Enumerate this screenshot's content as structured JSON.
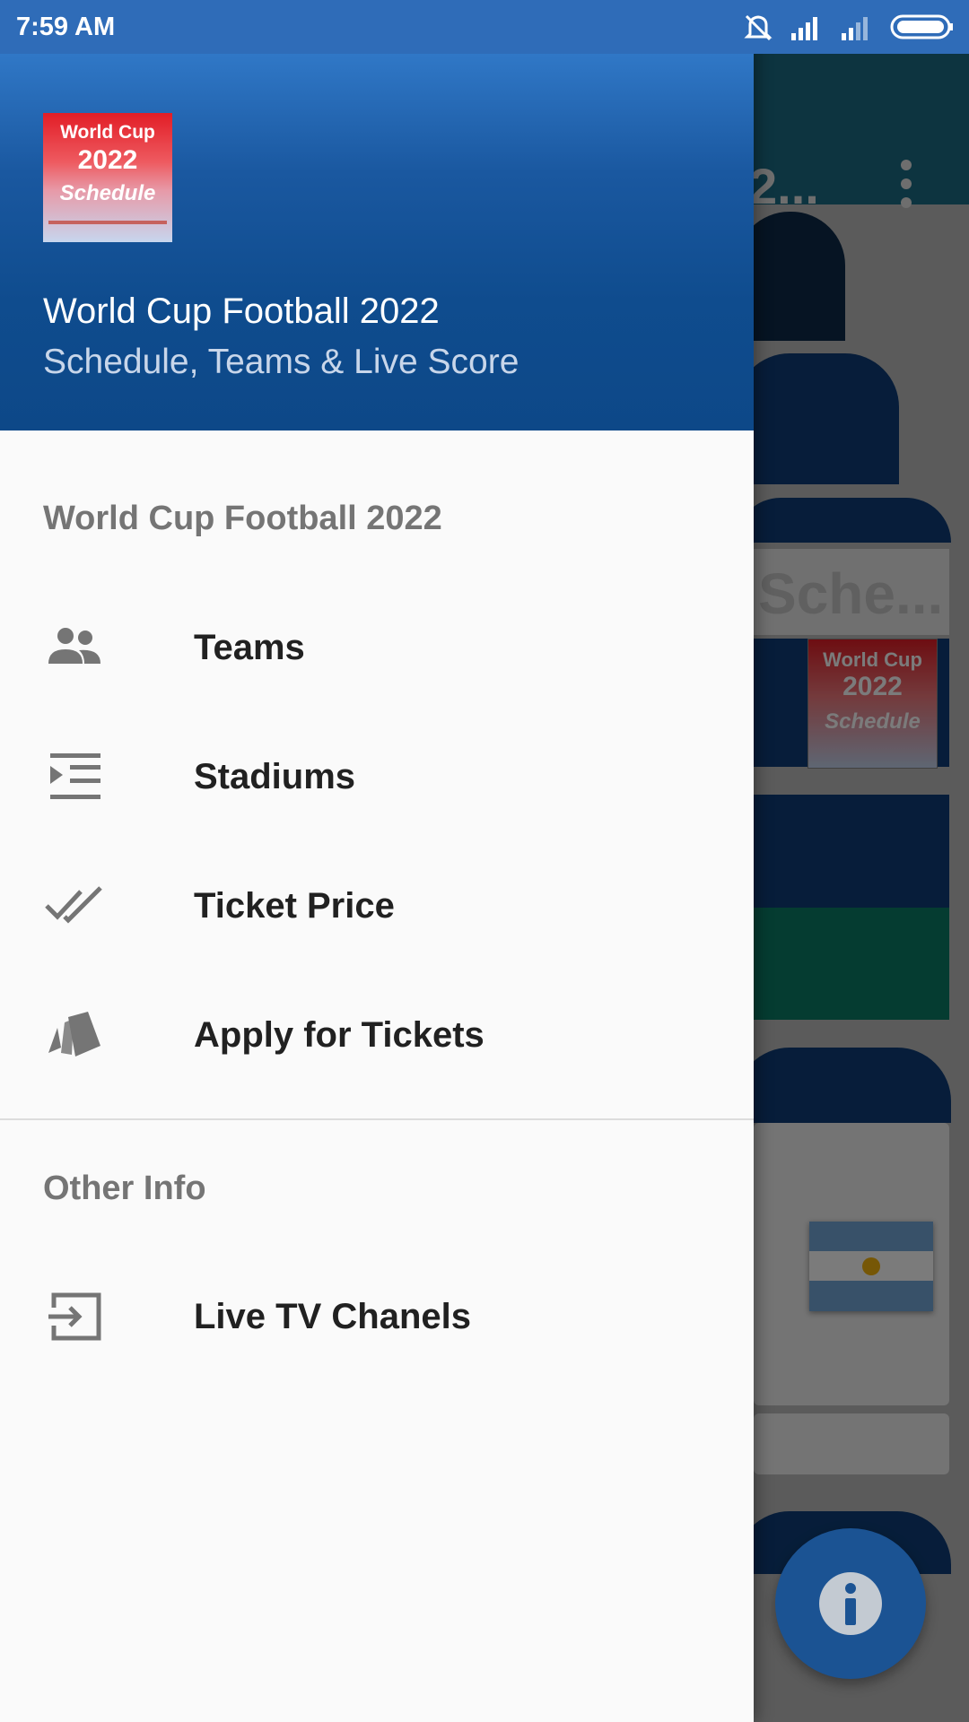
{
  "status_bar": {
    "time": "7:59 AM"
  },
  "background_app": {
    "toolbar_title": "2...",
    "schedule_text": "Sche...",
    "logo_lines": [
      "World Cup",
      "2022",
      "Schedule"
    ]
  },
  "drawer": {
    "header": {
      "logo_lines": [
        "World Cup",
        "2022",
        "Schedule"
      ],
      "title": "World Cup Football 2022",
      "subtitle": "Schedule, Teams & Live Score"
    },
    "sections": [
      {
        "label": "World Cup Football 2022",
        "items": [
          {
            "label": "Teams",
            "icon": "group-icon"
          },
          {
            "label": "Stadiums",
            "icon": "format-indent-icon"
          },
          {
            "label": "Ticket Price",
            "icon": "double-check-icon"
          },
          {
            "label": "Apply for Tickets",
            "icon": "cards-icon"
          }
        ]
      },
      {
        "label": "Other Info",
        "items": [
          {
            "label": "Live TV Chanels",
            "icon": "input-icon"
          }
        ]
      }
    ]
  },
  "colors": {
    "header_top": "#3a86d8",
    "header_bottom": "#0d4888",
    "status_bar": "#2f6cb8",
    "drawer_bg": "#fafafa",
    "fab": "#1f5fa8"
  }
}
